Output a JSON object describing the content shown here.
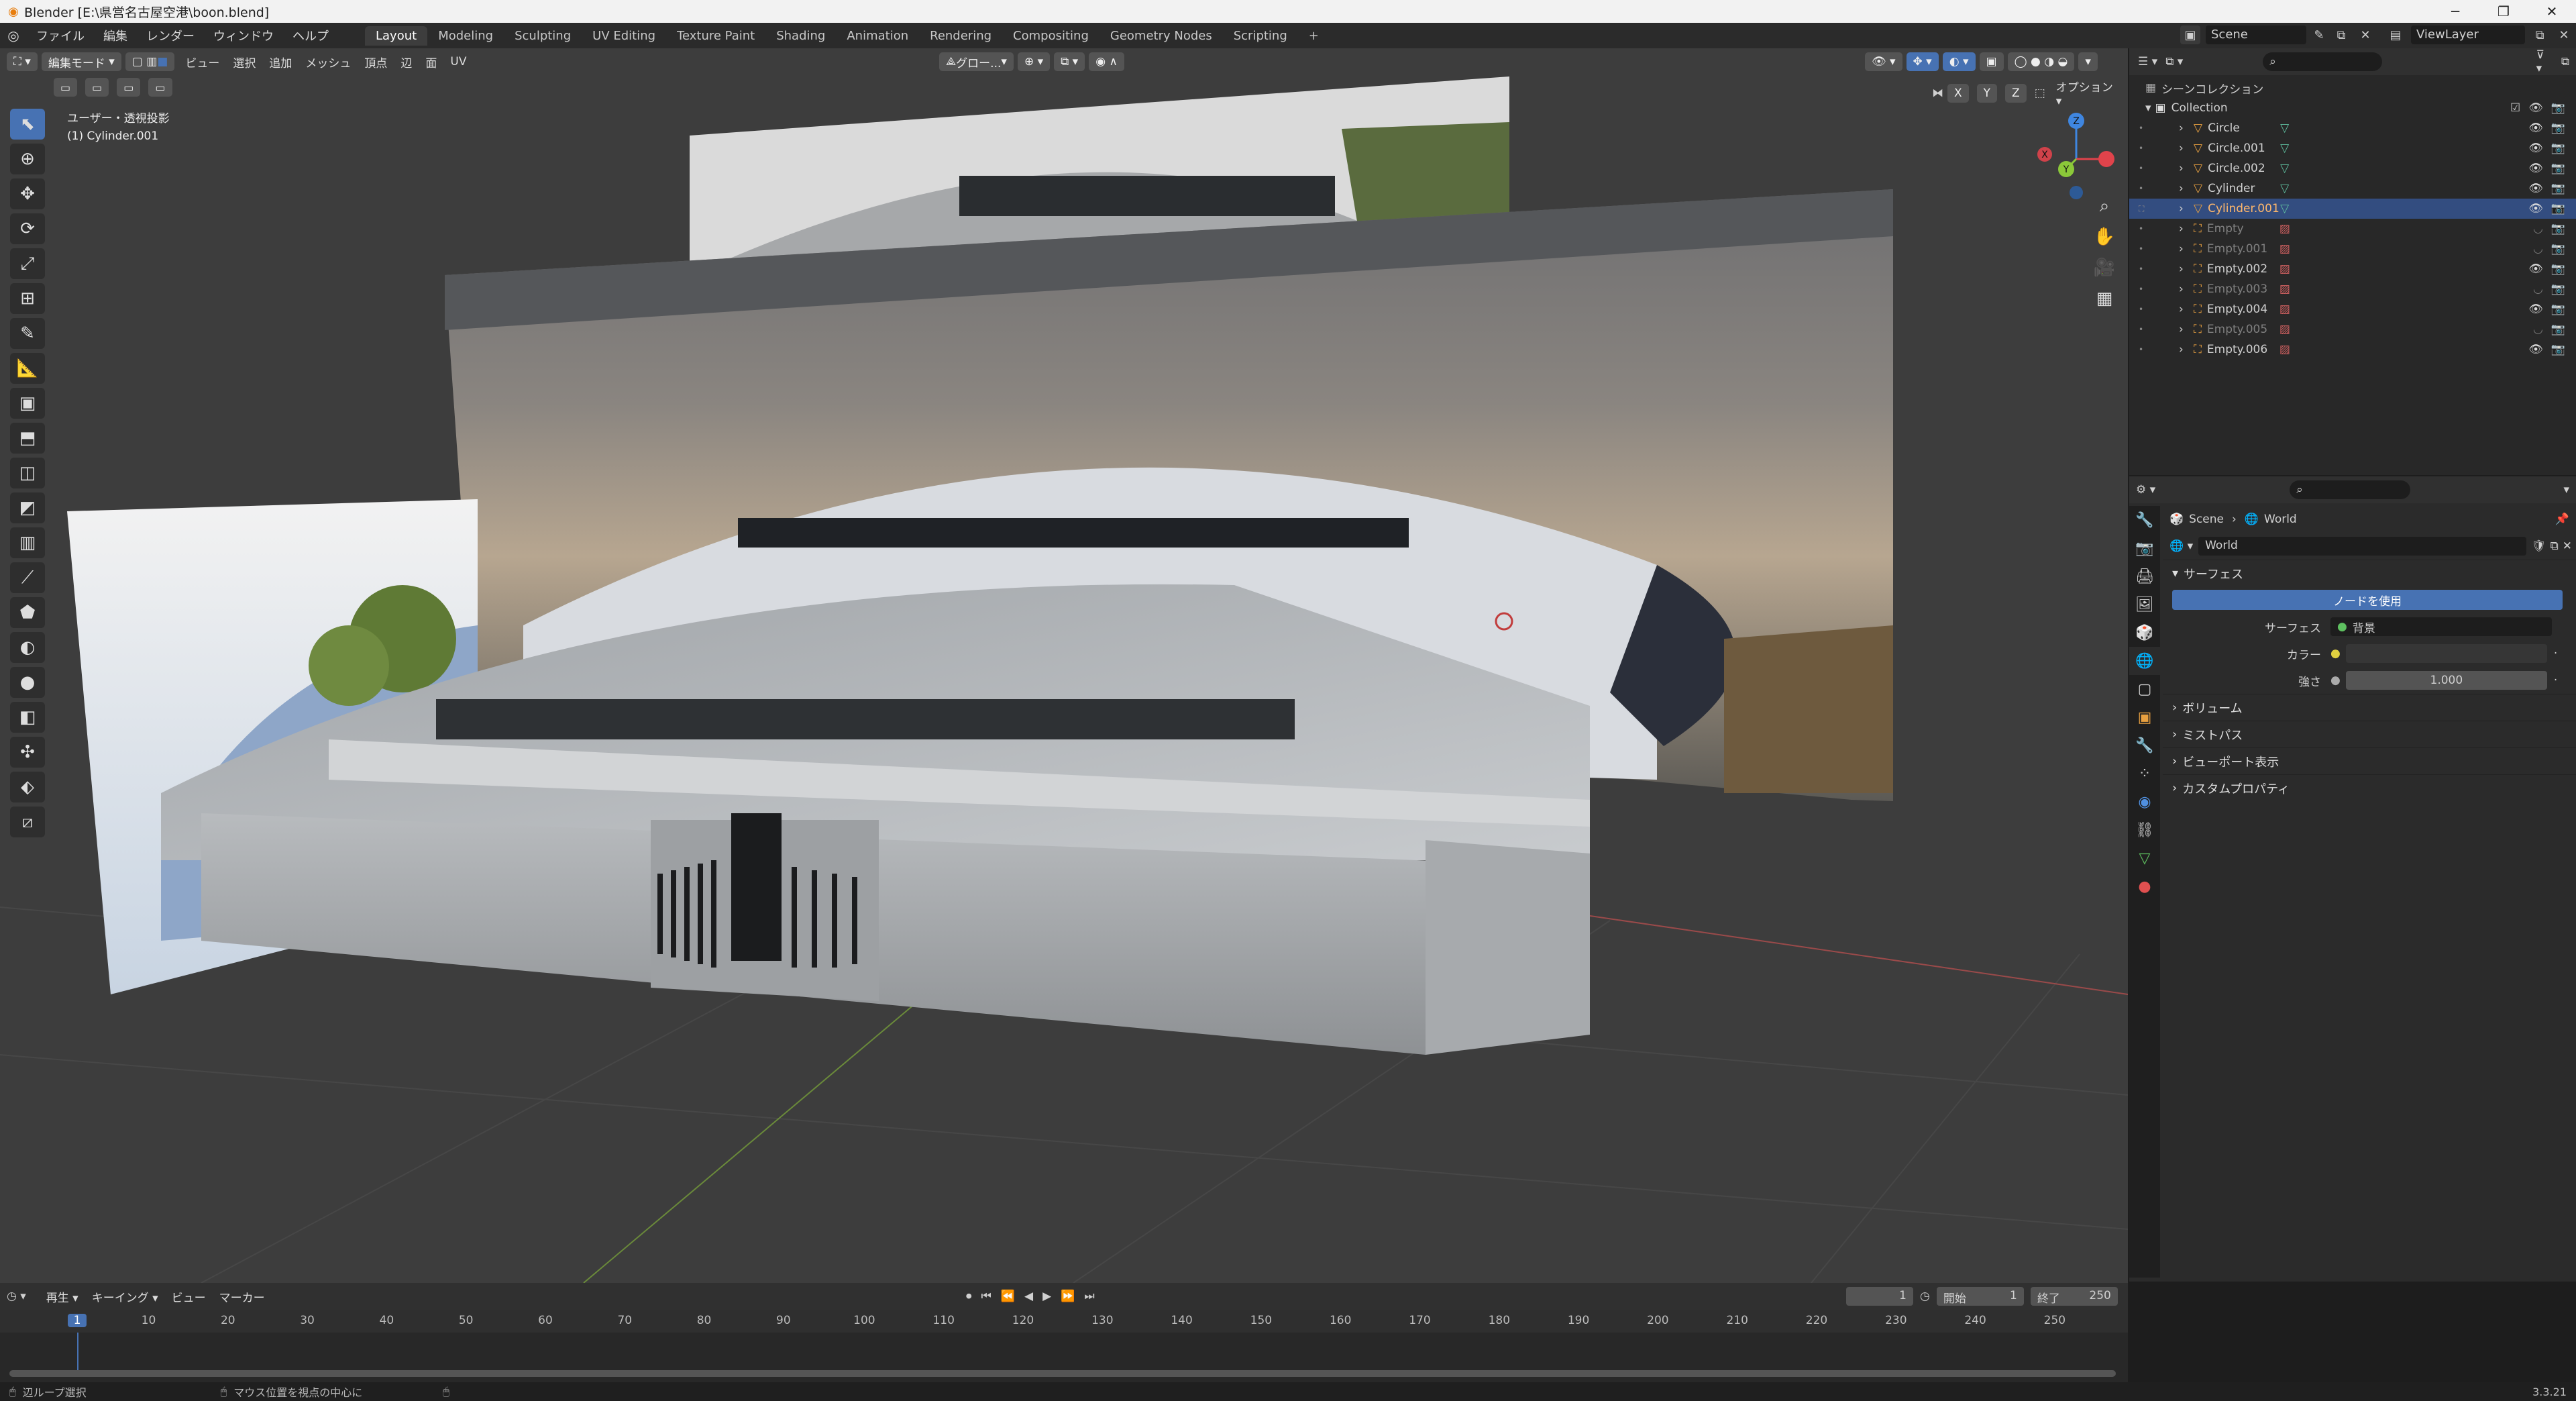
{
  "window": {
    "title": "Blender [E:\\県営名古屋空港\\boon.blend]",
    "min_icon": "minimize-icon",
    "max_icon": "maximize-icon",
    "close_icon": "close-icon"
  },
  "menu": {
    "items": [
      "ファイル",
      "編集",
      "レンダー",
      "ウィンドウ",
      "ヘルプ"
    ],
    "workspaces": [
      "Layout",
      "Modeling",
      "Sculpting",
      "UV Editing",
      "Texture Paint",
      "Shading",
      "Animation",
      "Rendering",
      "Compositing",
      "Geometry Nodes",
      "Scripting"
    ],
    "active_workspace": "Layout",
    "add_tab": "+",
    "scene": "Scene",
    "view_layer": "ViewLayer"
  },
  "viewport": {
    "mode": "編集モード",
    "header_menus": [
      "ビュー",
      "選択",
      "追加",
      "メッシュ",
      "頂点",
      "辺",
      "面",
      "UV"
    ],
    "transform": "グロー...",
    "axes": [
      "X",
      "Y",
      "Z"
    ],
    "options": "オプション",
    "overlay_text_1": "ユーザー・透視投影",
    "overlay_text_2": "(1) Cylinder.001",
    "gizmo_axes": {
      "x": "X",
      "y": "Y",
      "z": "Z"
    },
    "colors": {
      "x": "#e0434b",
      "y": "#8bc839",
      "z": "#3f86e0",
      "bg": "#3d3d3d"
    }
  },
  "outliner": {
    "search_placeholder": "",
    "scene_collection": "シーンコレクション",
    "collection": "Collection",
    "items": [
      {
        "name": "Circle",
        "type": "mesh",
        "selected": false,
        "dim": false
      },
      {
        "name": "Circle.001",
        "type": "mesh",
        "selected": false,
        "dim": false
      },
      {
        "name": "Circle.002",
        "type": "mesh",
        "selected": false,
        "dim": false
      },
      {
        "name": "Cylinder",
        "type": "mesh",
        "selected": false,
        "dim": false
      },
      {
        "name": "Cylinder.001",
        "type": "mesh",
        "selected": true,
        "dim": false
      },
      {
        "name": "Empty",
        "type": "empty",
        "selected": false,
        "dim": true
      },
      {
        "name": "Empty.001",
        "type": "empty",
        "selected": false,
        "dim": true
      },
      {
        "name": "Empty.002",
        "type": "empty",
        "selected": false,
        "dim": false
      },
      {
        "name": "Empty.003",
        "type": "empty",
        "selected": false,
        "dim": true
      },
      {
        "name": "Empty.004",
        "type": "empty",
        "selected": false,
        "dim": false
      },
      {
        "name": "Empty.005",
        "type": "empty",
        "selected": false,
        "dim": true
      },
      {
        "name": "Empty.006",
        "type": "empty",
        "selected": false,
        "dim": false
      }
    ]
  },
  "properties": {
    "breadcrumb_scene": "Scene",
    "breadcrumb_world": "World",
    "world_name": "World",
    "surface_panel": "サーフェス",
    "use_nodes_button": "ノードを使用",
    "surface_label": "サーフェス",
    "surface_value": "背景",
    "color_label": "カラー",
    "strength_label": "強さ",
    "strength_value": "1.000",
    "panels": [
      "ボリューム",
      "ミストパス",
      "ビューポート表示",
      "カスタムプロパティ"
    ]
  },
  "timeline": {
    "menus": [
      "再生",
      "キーイング",
      "ビュー",
      "マーカー"
    ],
    "current_frame": "1",
    "start_label": "開始",
    "start": "1",
    "end_label": "終了",
    "end": "250",
    "ticks": [
      "1",
      "10",
      "20",
      "30",
      "40",
      "50",
      "60",
      "70",
      "80",
      "90",
      "100",
      "110",
      "120",
      "130",
      "140",
      "150",
      "160",
      "170",
      "180",
      "190",
      "200",
      "210",
      "220",
      "230",
      "240",
      "250"
    ]
  },
  "status": {
    "left": "辺ループ選択",
    "middle": "マウス位置を視点の中心に",
    "version": "3.3.21"
  }
}
